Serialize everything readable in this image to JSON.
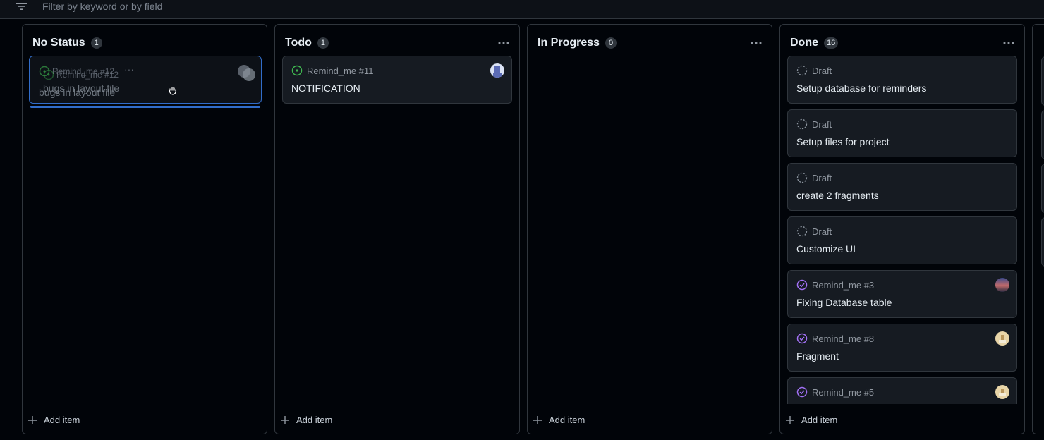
{
  "filter": {
    "placeholder": "Filter by keyword or by field"
  },
  "columns": {
    "no_status": {
      "title": "No Status",
      "count": "1",
      "dragged_card": {
        "ref": "Remind_me #12",
        "title": "bugs in layout file"
      },
      "add_item": "Add item"
    },
    "todo": {
      "title": "Todo",
      "count": "1",
      "cards": [
        {
          "ref": "Remind_me #11",
          "title": "NOTIFICATION"
        }
      ],
      "add_item": "Add item"
    },
    "in_progress": {
      "title": "In Progress",
      "count": "0",
      "add_item": "Add item"
    },
    "done": {
      "title": "Done",
      "count": "16",
      "cards": [
        {
          "ref": "Draft",
          "title": "Setup database for reminders"
        },
        {
          "ref": "Draft",
          "title": "Setup files for project"
        },
        {
          "ref": "Draft",
          "title": "create 2 fragments"
        },
        {
          "ref": "Draft",
          "title": "Customize UI"
        },
        {
          "ref": "Remind_me #3",
          "title": "Fixing Database table"
        },
        {
          "ref": "Remind_me #8",
          "title": "Fragment"
        },
        {
          "ref": "Remind_me #5",
          "title": ""
        }
      ],
      "add_item": "Add item"
    }
  },
  "colors": {
    "open": "#3fb950",
    "closed": "#a371f7",
    "draft": "#8b949e",
    "accent": "#316dca"
  }
}
